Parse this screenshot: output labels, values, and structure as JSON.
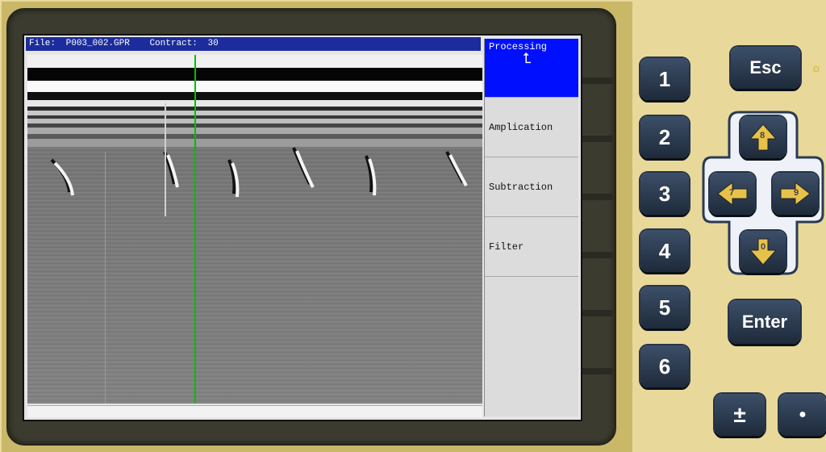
{
  "screen": {
    "file_label": "File:",
    "file_value": "P003_002.GPR",
    "contract_label": "Contract:",
    "contract_value": "30"
  },
  "menu": {
    "items": [
      {
        "label": "Processing",
        "active": true,
        "icon": "return-up-icon"
      },
      {
        "label": "Amplication",
        "active": false
      },
      {
        "label": "Subtraction",
        "active": false
      },
      {
        "label": "Filter",
        "active": false
      }
    ]
  },
  "keypad": {
    "esc": "Esc",
    "enter": "Enter",
    "numbers": [
      "1",
      "2",
      "3",
      "4",
      "5",
      "6"
    ],
    "up": "8",
    "left": "7",
    "right": "9",
    "down": "0",
    "plusminus": "±",
    "dot": "●"
  },
  "colors": {
    "title_bar": "#1c2c9c",
    "menu_active": "#0010ff",
    "cursor_line": "#00c000",
    "device_body": "#e8d89a",
    "arrow_fill": "#e7c24a"
  }
}
